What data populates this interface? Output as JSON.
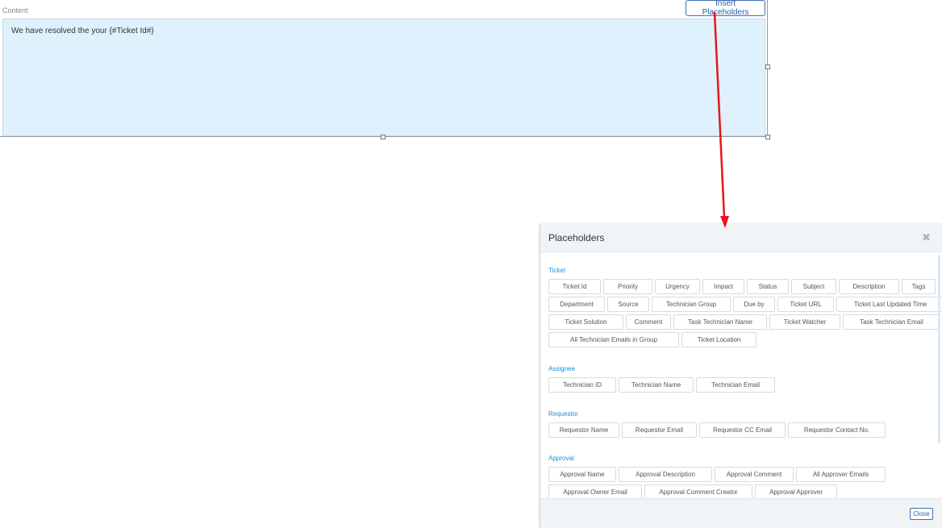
{
  "content_label": "Content",
  "editor_text": "We have resolved the your {#Ticket Id#}",
  "insert_placeholders_label": "Insert Placeholders",
  "accent_color": "#1a8fd8",
  "annotation_arrow_color": "#e8151b",
  "modal": {
    "title": "Placeholders",
    "close_icon": "close-icon",
    "close_label": "Close",
    "sections": [
      {
        "title": "Ticket",
        "rows": [
          [
            "Ticket Id",
            "Priority",
            "Urgency",
            "Impact",
            "Status",
            "Subject",
            "Description",
            "Tags"
          ],
          [
            "Department",
            "Source",
            "Technician Group",
            "Due by",
            "Ticket URL",
            "Ticket Last Updated Time"
          ],
          [
            "Ticket Solution",
            "Comment",
            "Task Technician Name",
            "Ticket Watcher",
            "Task Technician Email"
          ],
          [
            "All Technician Emails in Group",
            "Ticket Location"
          ]
        ]
      },
      {
        "title": "Assignee",
        "rows": [
          [
            "Technician ID",
            "Technician Name",
            "Technician Email"
          ]
        ]
      },
      {
        "title": "Requestor",
        "rows": [
          [
            "Requestor Name",
            "Requestor Email",
            "Requestor CC Email",
            "Requestor Contact No."
          ]
        ]
      },
      {
        "title": "Approval",
        "rows": [
          [
            "Approval Name",
            "Approval Description",
            "Approval Comment",
            "All Approver Emails"
          ],
          [
            "Approval Owner Email",
            "Approval Comment Creator",
            "Approval Approver"
          ]
        ]
      }
    ]
  }
}
